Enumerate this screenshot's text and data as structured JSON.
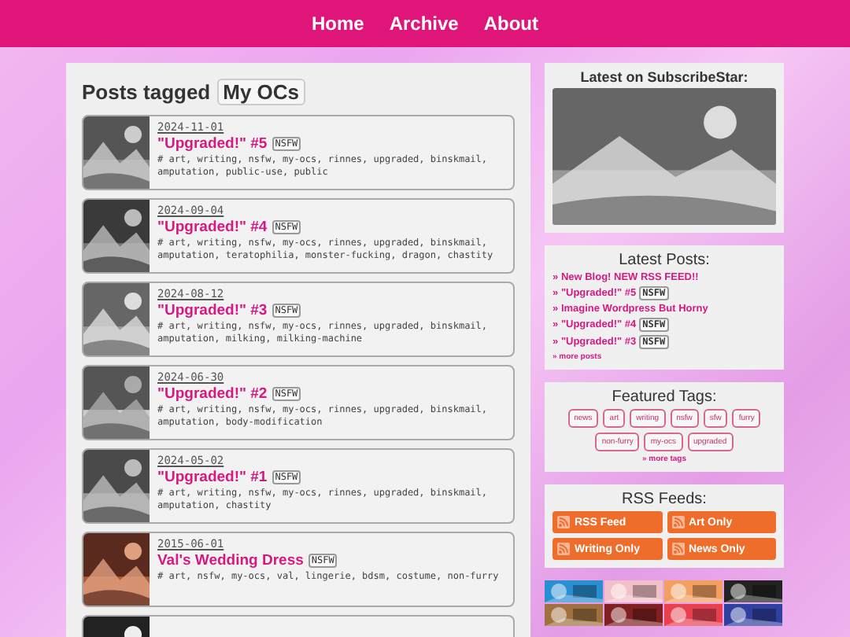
{
  "nav": [
    "Home",
    "Archive",
    "About"
  ],
  "heading": {
    "label": "Posts tagged",
    "tag": "My OCs"
  },
  "posts": [
    {
      "date": "2024-11-01",
      "title": "\"Upgraded!\" #5",
      "badge": "NSFW",
      "tags": "# art, writing, nsfw, my-ocs, rinnes, upgraded, binskmail, amputation, public-use, public",
      "thumb": {
        "kind": "picture"
      }
    },
    {
      "date": "2024-09-04",
      "title": "\"Upgraded!\" #4",
      "badge": "NSFW",
      "tags": "# art, writing, nsfw, my-ocs, rinnes, upgraded, binskmail, amputation, teratophilia, monster-fucking, dragon, chastity",
      "thumb": {
        "kind": "picture"
      }
    },
    {
      "date": "2024-08-12",
      "title": "\"Upgraded!\" #3",
      "badge": "NSFW",
      "tags": "# art, writing, nsfw, my-ocs, rinnes, upgraded, binskmail, amputation, milking, milking-machine",
      "thumb": {
        "kind": "picture"
      }
    },
    {
      "date": "2024-06-30",
      "title": "\"Upgraded!\" #2",
      "badge": "NSFW",
      "tags": "# art, writing, nsfw, my-ocs, rinnes, upgraded, binskmail, amputation, body-modification",
      "thumb": {
        "kind": "picture"
      }
    },
    {
      "date": "2024-05-02",
      "title": "\"Upgraded!\" #1",
      "badge": "NSFW",
      "tags": "# art, writing, nsfw, my-ocs, rinnes, upgraded, binskmail, amputation, chastity",
      "thumb": {
        "kind": "picture"
      }
    },
    {
      "date": "2015-06-01",
      "title": "Val's Wedding Dress",
      "badge": "NSFW",
      "tags": "# art, nsfw, my-ocs, val, lingerie, bdsm, costume, non-furry",
      "thumb": {
        "kind": "picture"
      }
    }
  ],
  "partial_post": {
    "thumb": {
      "kind": "picture"
    }
  },
  "subscribestar": {
    "title": "Latest on SubscribeStar:",
    "image": {
      "kind": "picture"
    }
  },
  "latest": {
    "title": "Latest Posts:",
    "marker": "»",
    "items": [
      {
        "label": "New Blog! NEW RSS FEED!!"
      },
      {
        "label": "\"Upgraded!\" #5",
        "badge": "NSFW"
      },
      {
        "label": "Imagine Wordpress But Horny"
      },
      {
        "label": "\"Upgraded!\" #4",
        "badge": "NSFW"
      },
      {
        "label": "\"Upgraded!\" #3",
        "badge": "NSFW"
      }
    ],
    "more": "» more posts"
  },
  "featured": {
    "title": "Featured Tags:",
    "tags": [
      "news",
      "art",
      "writing",
      "nsfw",
      "sfw",
      "furry",
      "non-furry",
      "my-ocs",
      "upgraded"
    ],
    "more": "» more tags"
  },
  "rss": {
    "title": "RSS Feeds:",
    "buttons": [
      "RSS Feed",
      "Art Only",
      "Writing Only",
      "News Only"
    ]
  },
  "banners": [
    {
      "kind": "picture"
    },
    {
      "kind": "picture"
    },
    {
      "kind": "picture"
    },
    {
      "kind": "picture"
    },
    {
      "kind": "picture"
    },
    {
      "kind": "picture"
    },
    {
      "kind": "picture"
    },
    {
      "kind": "picture"
    }
  ]
}
